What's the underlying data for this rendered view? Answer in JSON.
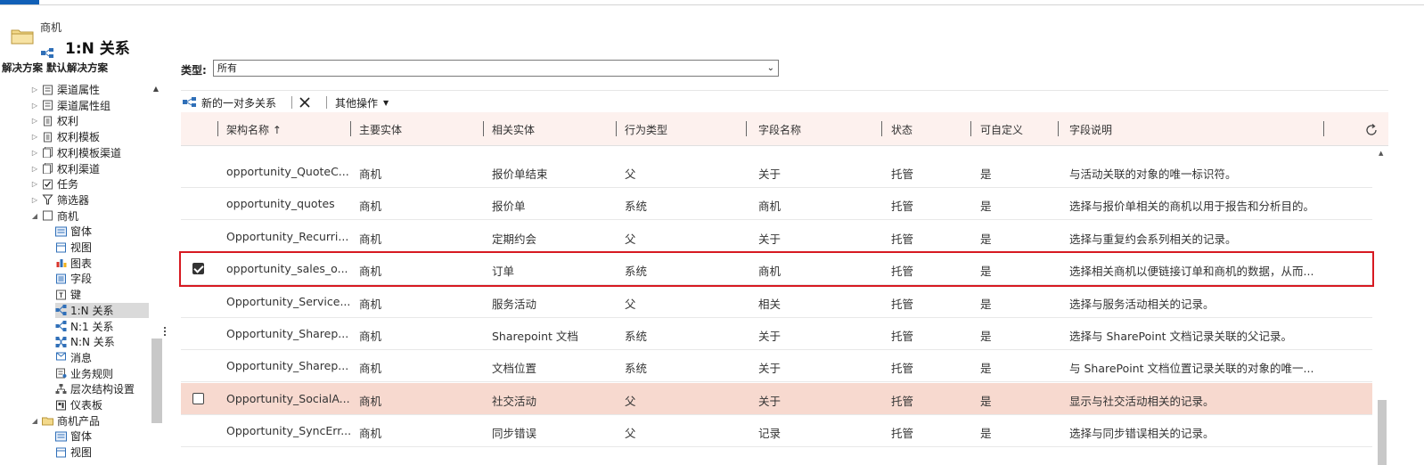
{
  "header": {
    "entity_name": "商机",
    "page_title": "1:N 关系"
  },
  "solution_label": "解决方案 默认解决方案",
  "tree": {
    "items": [
      {
        "label": "渠道属性",
        "expand": "▷",
        "icon": "settings-grid-icon"
      },
      {
        "label": "渠道属性组",
        "expand": "▷",
        "icon": "settings-grid-icon"
      },
      {
        "label": "权利",
        "expand": "▷",
        "icon": "document-icon"
      },
      {
        "label": "权利模板",
        "expand": "▷",
        "icon": "document-icon"
      },
      {
        "label": "权利模板渠道",
        "expand": "▷",
        "icon": "document-stack-icon"
      },
      {
        "label": "权利渠道",
        "expand": "▷",
        "icon": "document-stack-icon"
      },
      {
        "label": "任务",
        "expand": "▷",
        "icon": "checkbox-icon"
      },
      {
        "label": "筛选器",
        "expand": "▷",
        "icon": "filter-icon"
      },
      {
        "label": "商机",
        "expand": "◢",
        "icon": "entity-box-icon"
      },
      {
        "label": "窗体",
        "expand": "",
        "icon": "form-icon"
      },
      {
        "label": "视图",
        "expand": "",
        "icon": "view-icon"
      },
      {
        "label": "图表",
        "expand": "",
        "icon": "chart-icon"
      },
      {
        "label": "字段",
        "expand": "",
        "icon": "field-icon"
      },
      {
        "label": "键",
        "expand": "",
        "icon": "key-icon"
      },
      {
        "label": "1:N 关系",
        "expand": "",
        "icon": "relationship-icon",
        "selected": true
      },
      {
        "label": "N:1 关系",
        "expand": "",
        "icon": "relationship-icon"
      },
      {
        "label": "N:N 关系",
        "expand": "",
        "icon": "relationship-nn-icon"
      },
      {
        "label": "消息",
        "expand": "",
        "icon": "message-icon"
      },
      {
        "label": "业务规则",
        "expand": "",
        "icon": "business-rule-icon"
      },
      {
        "label": "层次结构设置",
        "expand": "",
        "icon": "hierarchy-icon"
      },
      {
        "label": "仪表板",
        "expand": "",
        "icon": "dashboard-icon"
      },
      {
        "label": "商机产品",
        "expand": "◢",
        "icon": "product-folder-icon"
      },
      {
        "label": "窗体",
        "expand": "",
        "icon": "form-icon"
      },
      {
        "label": "视图",
        "expand": "",
        "icon": "view-icon"
      }
    ]
  },
  "filter": {
    "type_label": "类型:",
    "type_value": "所有"
  },
  "toolbar": {
    "new_label": "新的一对多关系",
    "more_label": "其他操作"
  },
  "grid": {
    "columns": [
      "架构名称 ↑",
      "主要实体",
      "相关实体",
      "行为类型",
      "字段名称",
      "状态",
      "可自定义",
      "字段说明"
    ],
    "rows": [
      {
        "name": "opportunity_QuoteC...",
        "primary": "商机",
        "related": "报价单结束",
        "behavior": "父",
        "field": "关于",
        "state": "托管",
        "custom": "是",
        "desc": "与活动关联的对象的唯一标识符。",
        "checkbox": "none"
      },
      {
        "name": "opportunity_quotes",
        "primary": "商机",
        "related": "报价单",
        "behavior": "系统",
        "field": "商机",
        "state": "托管",
        "custom": "是",
        "desc": "选择与报价单相关的商机以用于报告和分析目的。",
        "checkbox": "none"
      },
      {
        "name": "Opportunity_Recurri...",
        "primary": "商机",
        "related": "定期约会",
        "behavior": "父",
        "field": "关于",
        "state": "托管",
        "custom": "是",
        "desc": "选择与重复约会系列相关的记录。",
        "checkbox": "none"
      },
      {
        "name": "opportunity_sales_o...",
        "primary": "商机",
        "related": "订单",
        "behavior": "系统",
        "field": "商机",
        "state": "托管",
        "custom": "是",
        "desc": "选择相关商机以便链接订单和商机的数据，从而...",
        "checkbox": "checked"
      },
      {
        "name": "Opportunity_Service...",
        "primary": "商机",
        "related": "服务活动",
        "behavior": "父",
        "field": "相关",
        "state": "托管",
        "custom": "是",
        "desc": "选择与服务活动相关的记录。",
        "checkbox": "none"
      },
      {
        "name": "Opportunity_Sharep...",
        "primary": "商机",
        "related": "Sharepoint 文档",
        "behavior": "系统",
        "field": "关于",
        "state": "托管",
        "custom": "是",
        "desc": "选择与 SharePoint 文档记录关联的父记录。",
        "checkbox": "none"
      },
      {
        "name": "Opportunity_Sharep...",
        "primary": "商机",
        "related": "文档位置",
        "behavior": "系统",
        "field": "关于",
        "state": "托管",
        "custom": "是",
        "desc": "与 SharePoint 文档位置记录关联的对象的唯一...",
        "checkbox": "none"
      },
      {
        "name": "Opportunity_SocialA...",
        "primary": "商机",
        "related": "社交活动",
        "behavior": "父",
        "field": "关于",
        "state": "托管",
        "custom": "是",
        "desc": "显示与社交活动相关的记录。",
        "checkbox": "unchecked"
      },
      {
        "name": "Opportunity_SyncErr...",
        "primary": "商机",
        "related": "同步错误",
        "behavior": "父",
        "field": "记录",
        "state": "托管",
        "custom": "是",
        "desc": "选择与同步错误相关的记录。",
        "checkbox": "none"
      }
    ]
  },
  "colors": {
    "header_bg": "#fdf1ee",
    "hover_row_bg": "#f7d9cf",
    "selection_outline": "#d71921",
    "accent": "#1160b7"
  }
}
